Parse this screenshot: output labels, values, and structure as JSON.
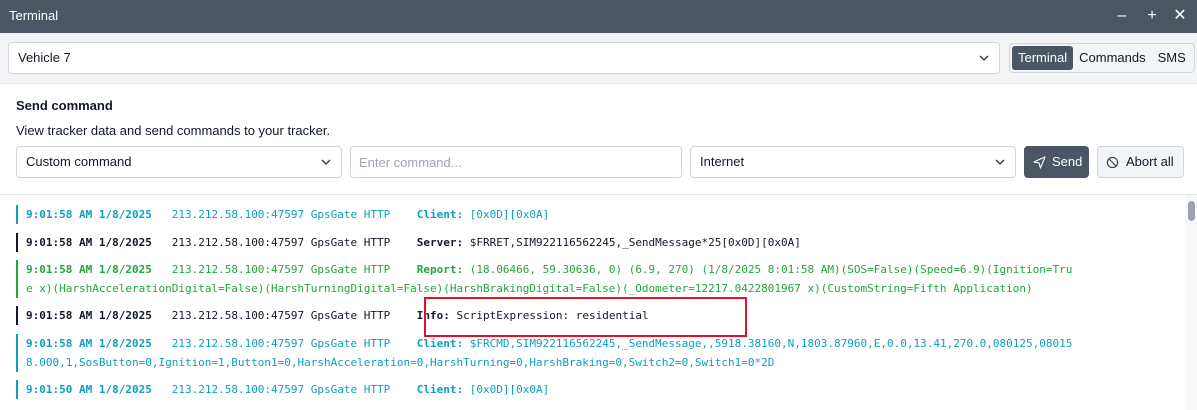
{
  "window": {
    "title": "Terminal"
  },
  "vehicle_select": {
    "value": "Vehicle 7"
  },
  "tabs": [
    {
      "label": "Terminal",
      "active": true
    },
    {
      "label": "Commands",
      "active": false
    },
    {
      "label": "SMS",
      "active": false
    }
  ],
  "send": {
    "heading": "Send command",
    "description": "View tracker data and send commands to your tracker.",
    "command_type": "Custom command",
    "command_placeholder": "Enter command...",
    "channel": "Internet",
    "send_label": "Send",
    "abort_label": "Abort all"
  },
  "log": [
    {
      "color": "teal",
      "lines": [
        {
          "ts": "9:01:58 AM 1/8/2025",
          "src": "213.212.58.100:47597 GpsGate HTTP",
          "kw": "Client:",
          "msg": "[0x0D][0x0A]"
        }
      ]
    },
    {
      "color": "dark",
      "lines": [
        {
          "ts": "9:01:58 AM 1/8/2025",
          "src": "213.212.58.100:47597 GpsGate HTTP",
          "kw": "Server:",
          "msg": "$FRRET,SIM922116562245,_SendMessage*25[0x0D][0x0A]"
        }
      ]
    },
    {
      "color": "green",
      "lines": [
        {
          "ts": "9:01:58 AM 1/8/2025",
          "src": "213.212.58.100:47597 GpsGate HTTP",
          "kw": "Report:",
          "msg": "(18.06466, 59.30636, 0) (6.9, 270) (1/8/2025 8:01:58 AM)(SOS=False)(Speed=6.9)(Ignition=Tru"
        },
        {
          "cont": "e x)(HarshAccelerationDigital=False)(HarshTurningDigital=False)(HarshBrakingDigital=False)(_Odometer=12217.0422801967 x)(CustomString=Fifth Application)"
        }
      ]
    },
    {
      "color": "dark",
      "lines": [
        {
          "ts": "9:01:58 AM 1/8/2025",
          "src": "213.212.58.100:47597 GpsGate HTTP",
          "kw": "Info:",
          "msg": "ScriptExpression: residential"
        }
      ]
    },
    {
      "color": "teal",
      "lines": [
        {
          "ts": "9:01:58 AM 1/8/2025",
          "src": "213.212.58.100:47597 GpsGate HTTP",
          "kw": "Client:",
          "msg": "$FRCMD,SIM922116562245,_SendMessage,,5918.38160,N,1803.87960,E,0.0,13.41,270.0,080125,08015"
        },
        {
          "cont": "8.000,1,SosButton=0,Ignition=1,Button1=0,HarshAcceleration=0,HarshTurning=0,HarshBraking=0,Switch2=0,Switch1=0*2D"
        }
      ]
    },
    {
      "color": "teal",
      "lines": [
        {
          "ts": "9:01:50 AM 1/8/2025",
          "src": "213.212.58.100:47597 GpsGate HTTP",
          "kw": "Client:",
          "msg": "[0x0D][0x0A]"
        }
      ]
    }
  ]
}
